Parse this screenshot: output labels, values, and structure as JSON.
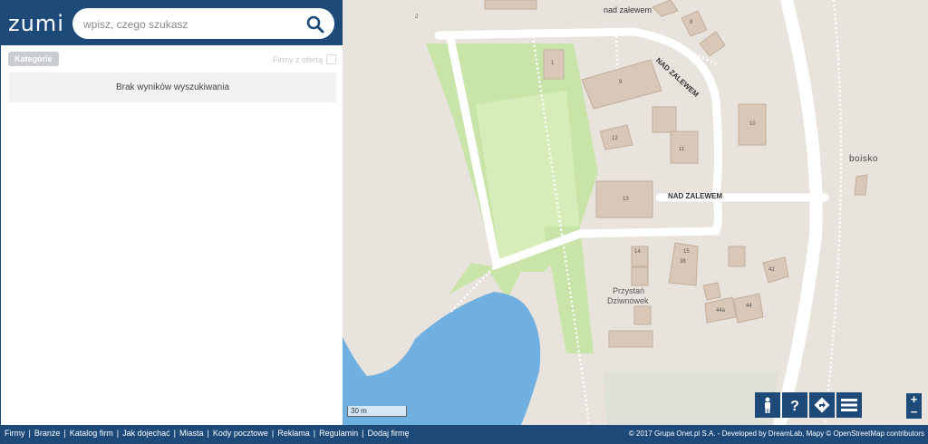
{
  "header": {
    "logo": "zumi",
    "search_placeholder": "wpisz, czego szukasz"
  },
  "sidebar": {
    "categories_label": "Kategorie",
    "firms_with_offer_label": "Firmy z ofertą",
    "no_results_text": "Brak wyników wyszukiwania"
  },
  "map": {
    "labels": {
      "field": "boisko",
      "street1": "NAD ZALEWEM",
      "street2": "NAD ZALEWEM",
      "street_top": "nad zalewem",
      "poi_line1": "Przystań",
      "poi_line2": "Dziwnówek",
      "n1": "1",
      "n2": "2",
      "n8": "8",
      "n9": "9",
      "n10": "10",
      "n11": "11",
      "n12": "12",
      "n13": "13",
      "n14": "14",
      "n15": "15",
      "n38": "38",
      "n42": "42",
      "n44": "44",
      "n44a": "44a"
    },
    "scale_label": "30 m"
  },
  "controls": [
    "person-icon",
    "help-icon",
    "directions-icon",
    "menu-icon"
  ],
  "zoom": {
    "in": "+",
    "out": "−"
  },
  "footer": {
    "links": [
      "Firmy",
      "Branże",
      "Katalog firm",
      "Jak dojechać",
      "Miasta",
      "Kody pocztowe",
      "Reklama",
      "Regulamin",
      "Dodaj firmę"
    ],
    "copyright": "© 2017 Grupa Onet.pl S.A. - Developed by DreamLab, Mapy © OpenStreetMap contributors"
  }
}
